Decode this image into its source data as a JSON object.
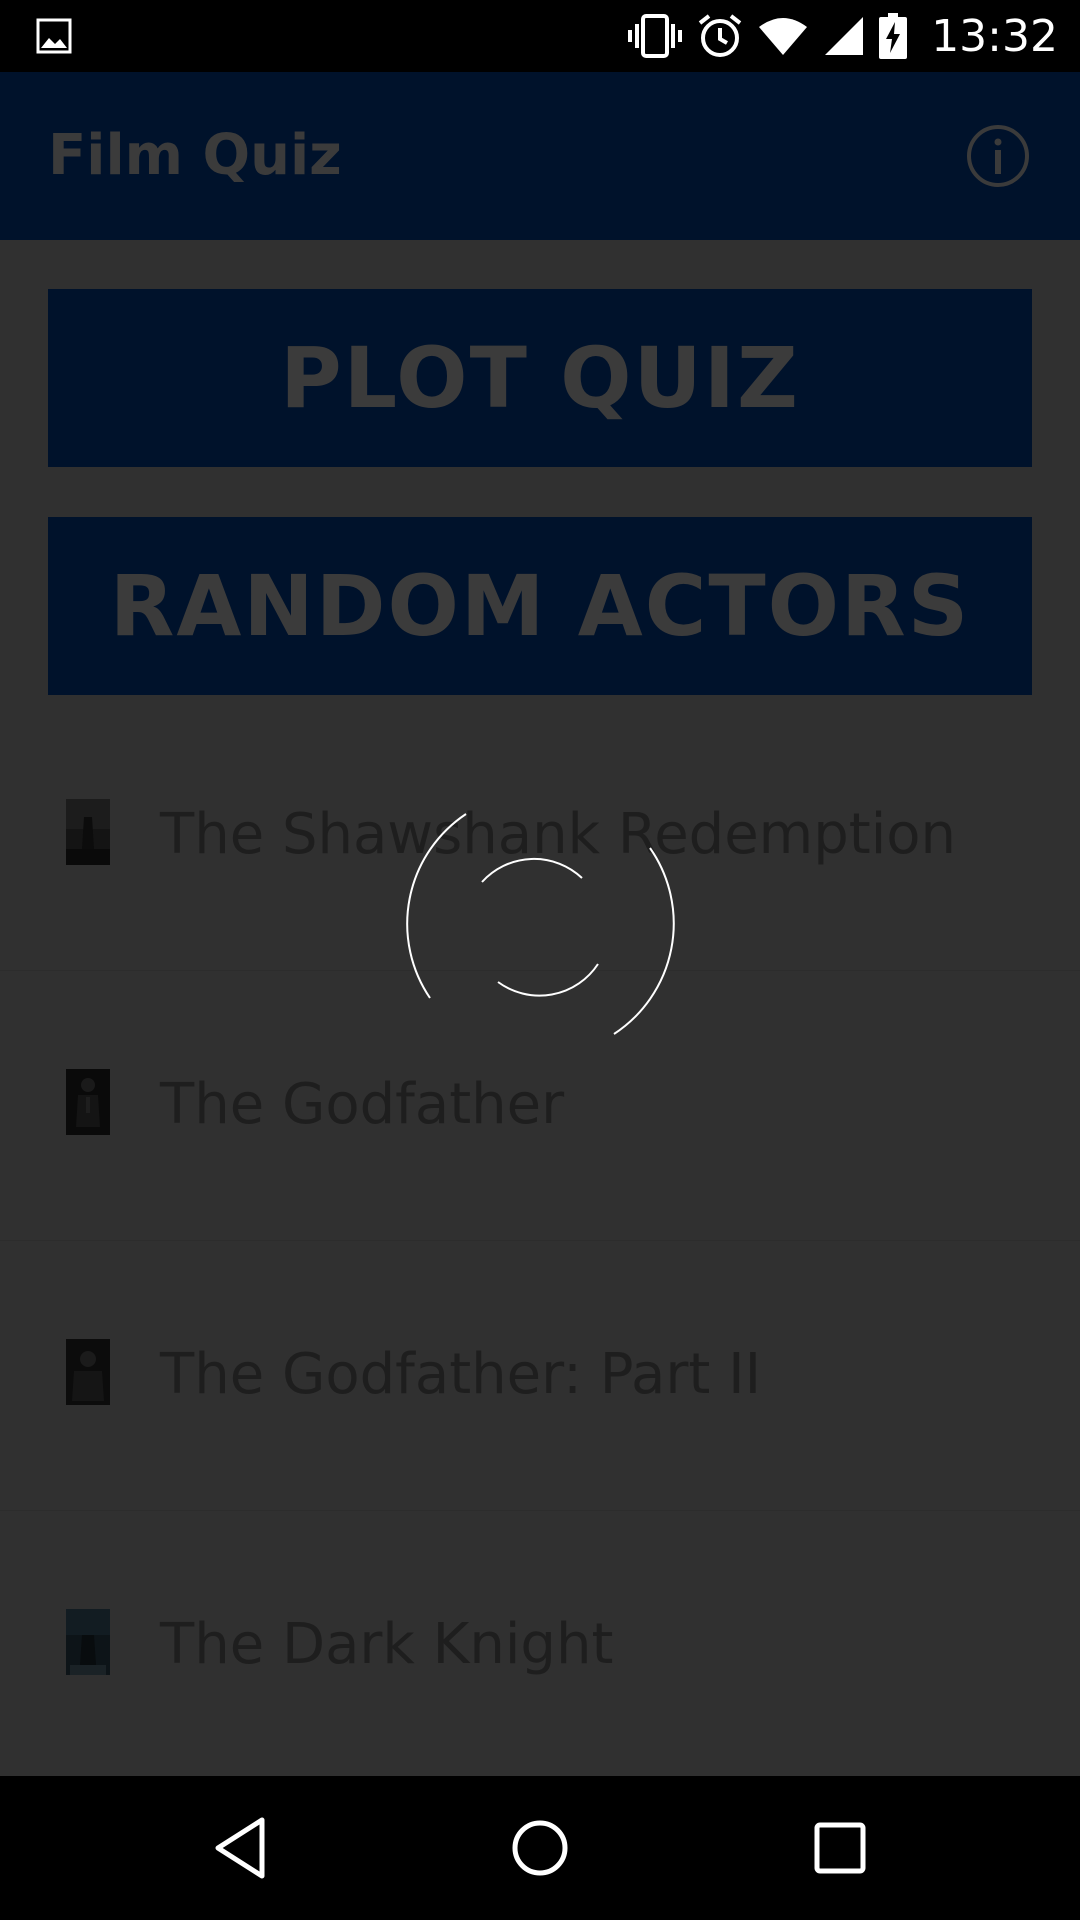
{
  "status_bar": {
    "time": "13:32",
    "icons": [
      "gallery-icon",
      "vibrate-icon",
      "alarm-icon",
      "wifi-icon",
      "signal-icon",
      "battery-charging-icon"
    ]
  },
  "app_bar": {
    "title": "Film Quiz",
    "info_icon": "info-icon"
  },
  "buttons": {
    "plot_quiz": "PLOT QUIZ",
    "random_actors": "RANDOM ACTORS"
  },
  "films": [
    {
      "title": "The Shawshank Redemption",
      "thumb": "poster-shawshank"
    },
    {
      "title": "The Godfather",
      "thumb": "poster-godfather"
    },
    {
      "title": "The Godfather: Part II",
      "thumb": "poster-godfather-2"
    },
    {
      "title": "The Dark Knight",
      "thumb": "poster-dark-knight"
    }
  ],
  "loading": {
    "icon": "loading-spinner-icon"
  },
  "nav_bar": {
    "icons": [
      "back-icon",
      "home-icon",
      "recent-apps-icon"
    ]
  },
  "colors": {
    "app_bar_bg": "#00122b",
    "scrim_bg": "#303030",
    "dimmed_text": "#3b3b3b",
    "list_text": "#1e1e1e"
  }
}
